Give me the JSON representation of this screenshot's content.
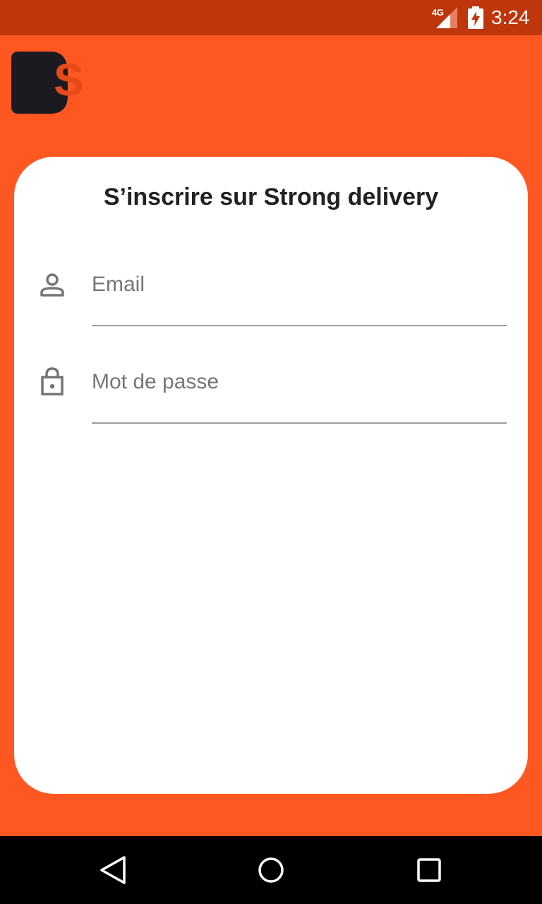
{
  "colors": {
    "status_bar": "#BF360C",
    "background": "#FF5722",
    "card": "#FFFFFF",
    "nav_bar": "#000000",
    "logo_dark": "#1B1A20",
    "logo_accent": "#E64A19"
  },
  "status_bar": {
    "network": "4G",
    "time": "3:24",
    "icons": [
      "signal-icon",
      "battery-charging-icon"
    ]
  },
  "logo": {
    "icon": "strong-delivery-logo-icon",
    "letter": "S"
  },
  "form": {
    "title": "S’inscrire sur Strong delivery",
    "email": {
      "icon": "person-icon",
      "placeholder": "Email",
      "value": ""
    },
    "password": {
      "icon": "lock-icon",
      "placeholder": "Mot de passe",
      "value": ""
    }
  },
  "nav_bar": {
    "buttons": [
      "back-icon",
      "home-icon",
      "recents-icon"
    ]
  }
}
